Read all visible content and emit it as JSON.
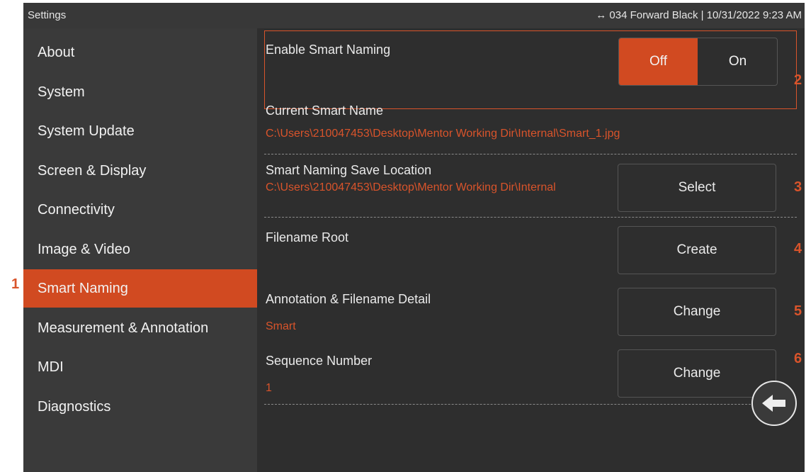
{
  "topbar": {
    "title": "Settings",
    "status": "↔ 034 Forward Black | 10/31/2022  9:23 AM"
  },
  "sidebar": {
    "items": [
      {
        "label": "About"
      },
      {
        "label": "System"
      },
      {
        "label": "System Update"
      },
      {
        "label": "Screen & Display"
      },
      {
        "label": "Connectivity"
      },
      {
        "label": "Image & Video"
      },
      {
        "label": "Smart Naming",
        "active": true
      },
      {
        "label": "Measurement & Annotation"
      },
      {
        "label": "MDI"
      },
      {
        "label": "Diagnostics"
      }
    ]
  },
  "content": {
    "enable_smart_naming": {
      "label": "Enable Smart Naming",
      "off_label": "Off",
      "on_label": "On",
      "value": "Off"
    },
    "current_smart_name": {
      "label": "Current Smart Name",
      "value": "C:\\Users\\210047453\\Desktop\\Mentor Working Dir\\Internal\\Smart_1.jpg"
    },
    "save_location": {
      "label": "Smart Naming Save Location",
      "value": "C:\\Users\\210047453\\Desktop\\Mentor Working Dir\\Internal",
      "button": "Select"
    },
    "filename_root": {
      "label": "Filename Root",
      "button": "Create"
    },
    "annotation_detail": {
      "label": "Annotation & Filename Detail",
      "value": "Smart",
      "button": "Change"
    },
    "sequence_number": {
      "label": "Sequence Number",
      "value": "1",
      "button": "Change"
    }
  },
  "callouts": [
    "1",
    "2",
    "3",
    "4",
    "5",
    "6"
  ],
  "icons": {
    "back": "arrow-left-icon"
  },
  "colors": {
    "accent": "#d14a21",
    "background": "#2e2e2e",
    "sidebar": "#3a3a3a"
  }
}
